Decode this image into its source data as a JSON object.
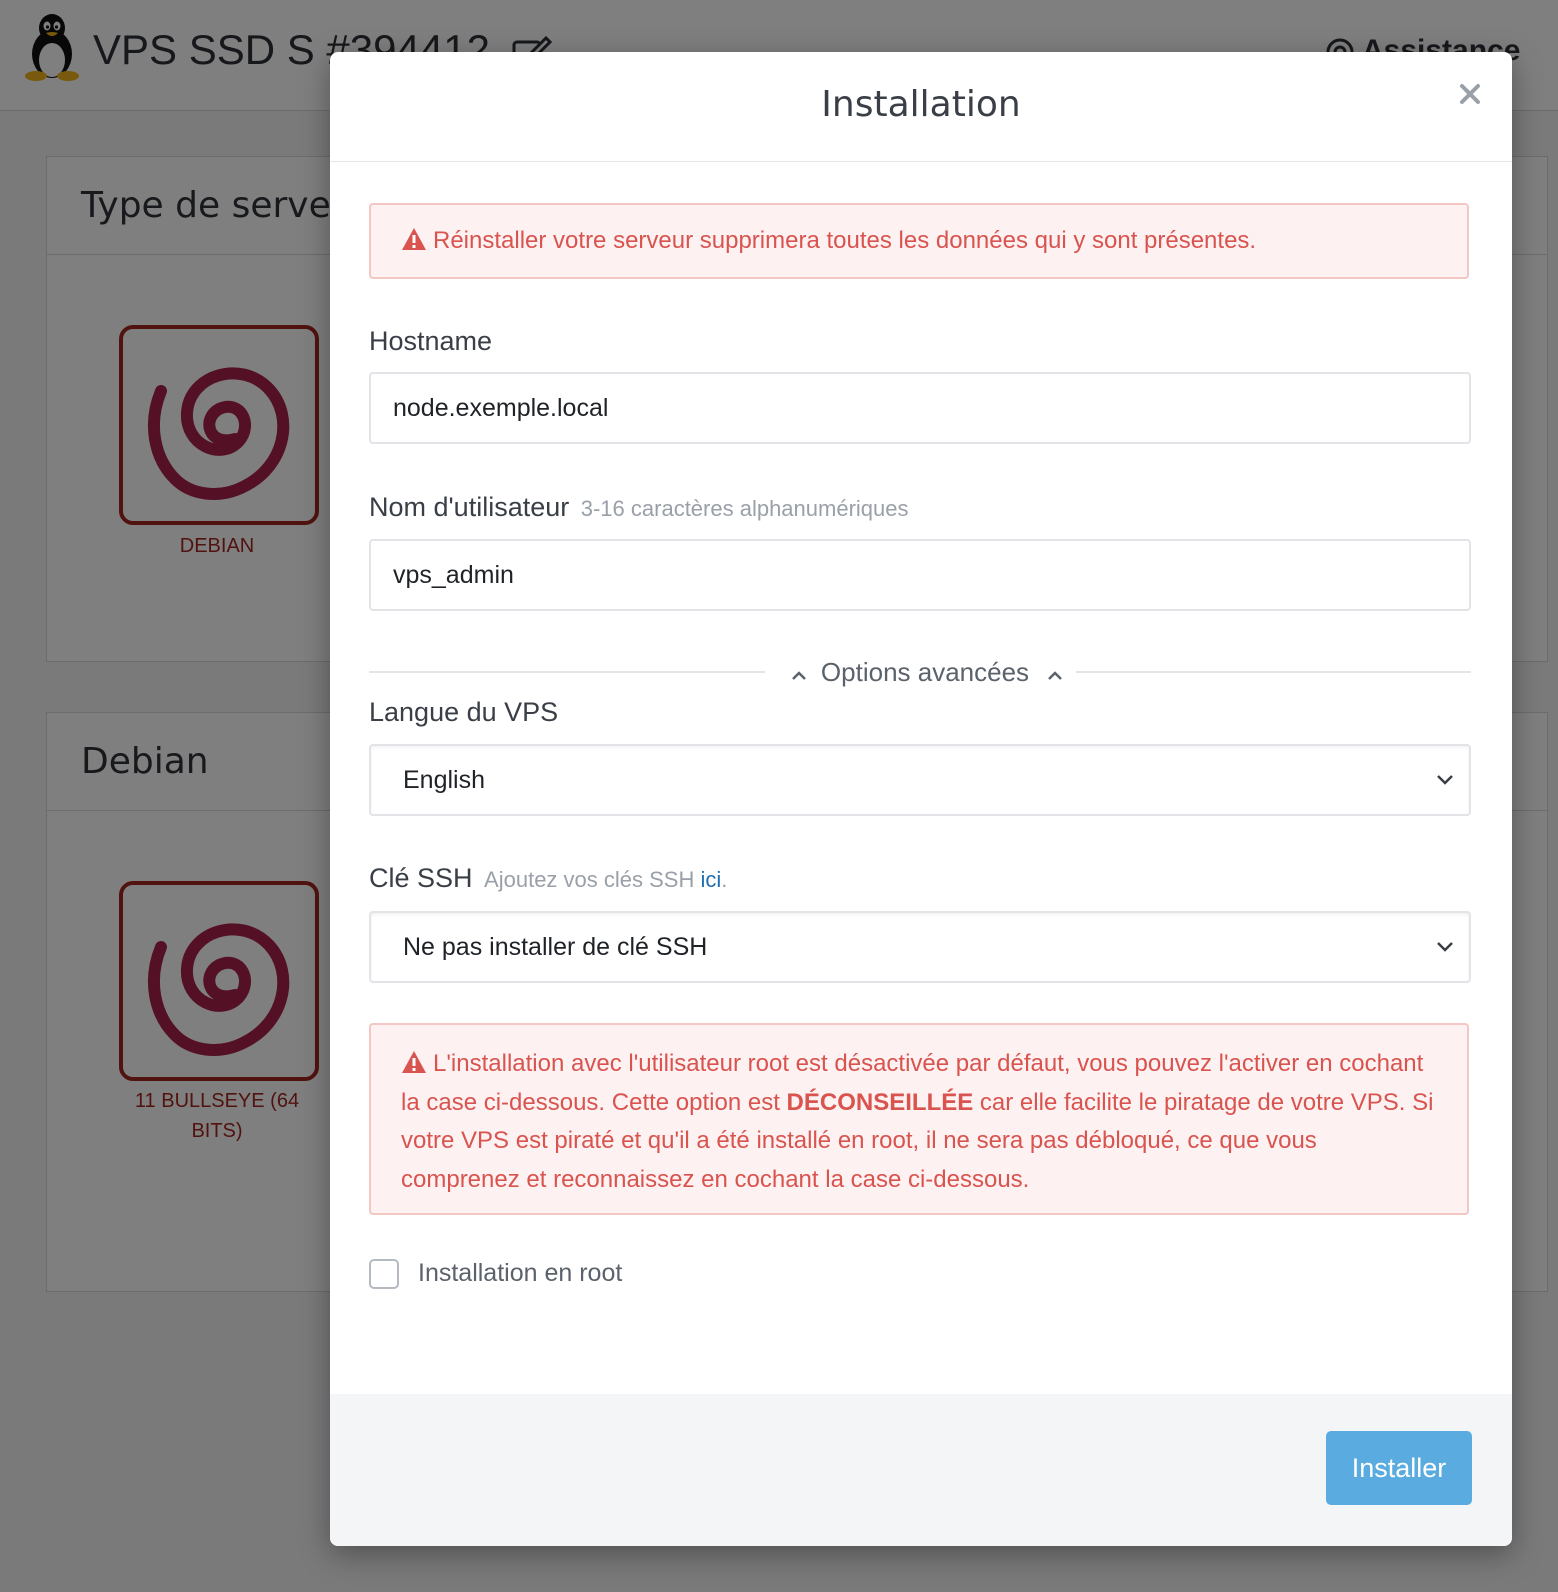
{
  "page": {
    "title": "VPS SSD S #394412",
    "assistance_label": "Assistance"
  },
  "panels": {
    "server_type": {
      "header": "Type de serveur",
      "os_label": "DEBIAN"
    },
    "distribution": {
      "header": "Debian",
      "version_label": "11 BULLSEYE (64 BITS)"
    }
  },
  "modal": {
    "title": "Installation",
    "warning_reinstall": "Réinstaller votre serveur supprimera toutes les données qui y sont présentes.",
    "hostname": {
      "label": "Hostname",
      "value": "node.exemple.local"
    },
    "username": {
      "label": "Nom d'utilisateur",
      "hint": "3-16 caractères alphanumériques",
      "value": "vps_admin"
    },
    "advanced_toggle": "Options avancées",
    "language": {
      "label": "Langue du VPS",
      "selected": "English"
    },
    "ssh_key": {
      "label": "Clé SSH",
      "hint_prefix": "Ajoutez vos clés SSH",
      "hint_link": "ici",
      "hint_suffix": ".",
      "selected": "Ne pas installer de clé SSH"
    },
    "root_warning": {
      "part1": "L'installation avec l'utilisateur root est désactivée par défaut, vous pouvez l'activer en cochant la case ci-dessous. Cette option est",
      "emphasis": "DÉCONSEILLÉE",
      "part2": "car elle facilite le piratage de votre VPS. Si votre VPS est piraté et qu'il a été installé en root, il ne sera pas débloqué, ce que vous comprenez et reconnaissez en cochant la case ci-dessous."
    },
    "root_checkbox": {
      "label": "Installation en root",
      "checked": false
    },
    "install_button": "Installer"
  },
  "colors": {
    "danger_text": "#d9534f",
    "danger_bg": "#fdf2f1",
    "primary_button": "#5aace0",
    "debian_red": "#a3271f",
    "link": "#1f6fb2"
  },
  "icons": [
    "tux-icon",
    "edit-icon",
    "lifebuoy-icon",
    "debian-swirl-icon",
    "close-icon",
    "warning-icon",
    "chevron-up-icon",
    "chevron-down-icon"
  ]
}
